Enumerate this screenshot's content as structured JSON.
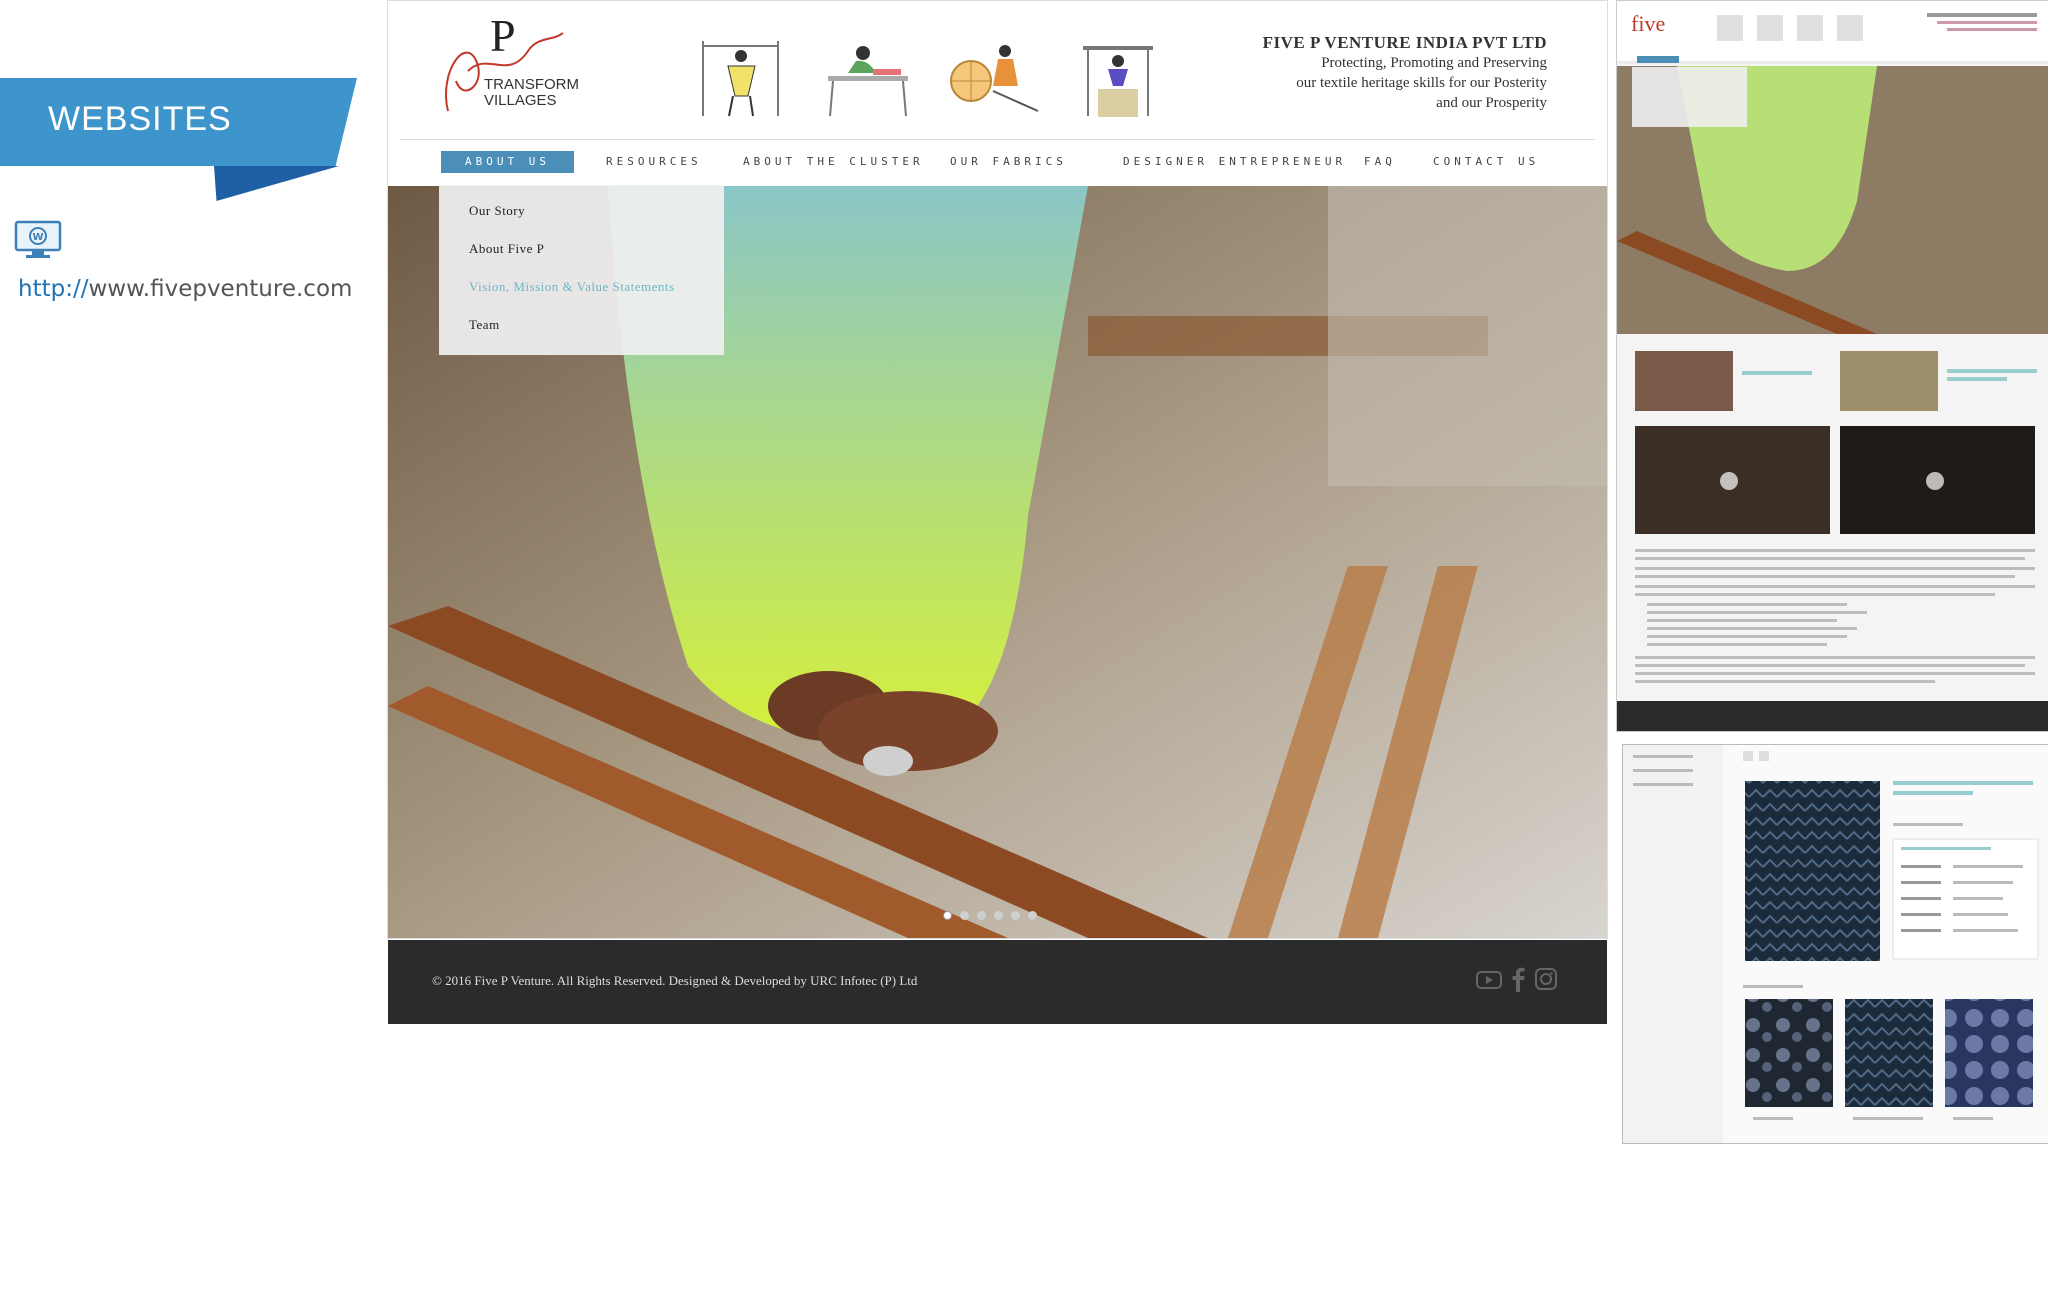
{
  "section": {
    "title": "WEBSITES"
  },
  "link": {
    "protocol": "http://",
    "host": "www.fivepventure.com"
  },
  "site": {
    "company": {
      "name": "FIVE P VENTURE INDIA PVT LTD",
      "tagline_lines": [
        "Protecting, Promoting and Preserving",
        "our textile heritage skills for our Posterity",
        "and our Prosperity"
      ]
    },
    "nav": [
      {
        "label": "ABOUT US"
      },
      {
        "label": "RESOURCES"
      },
      {
        "label": "ABOUT THE CLUSTER"
      },
      {
        "label": "OUR FABRICS"
      },
      {
        "label": "DESIGNER ENTREPRENEUR"
      },
      {
        "label": "FAQ"
      },
      {
        "label": "CONTACT US"
      }
    ],
    "dropdown": [
      {
        "label": "Our Story"
      },
      {
        "label": "About Five P"
      },
      {
        "label": "Vision, Mission & Value Statements"
      },
      {
        "label": "Team"
      }
    ],
    "footer": {
      "text": "© 2016 Five P Venture. All Rights Reserved. Designed & Developed by URC Infotec (P) Ltd"
    },
    "slides": {
      "count": 6,
      "active": 1
    },
    "icons": [
      "youtube-icon",
      "facebook-icon",
      "instagram-icon"
    ],
    "colors": {
      "nav_active": "#4b8fb8",
      "banner": "#3d95cc",
      "footer": "#2b2b2b",
      "highlight": "#c0392b"
    }
  }
}
